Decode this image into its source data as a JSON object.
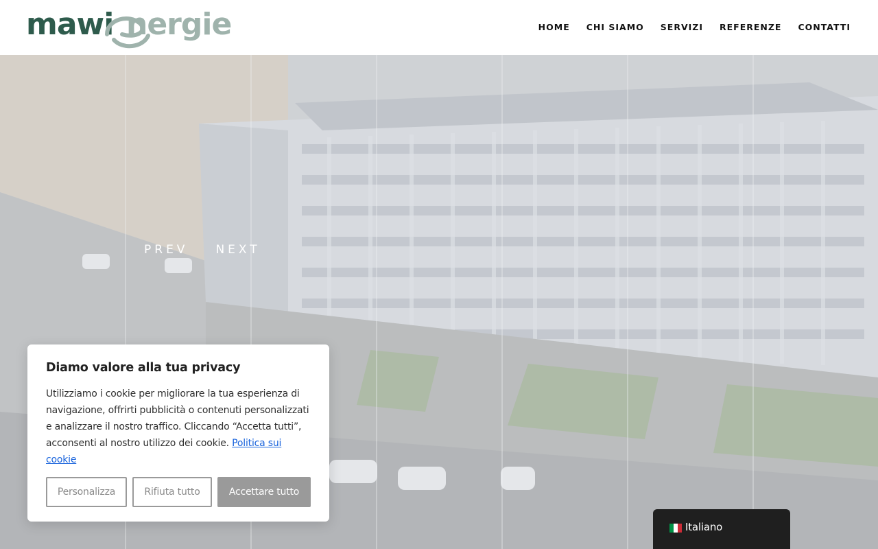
{
  "header": {
    "logo_part1": "mawi",
    "logo_part2": "nergie",
    "nav": [
      "HOME",
      "CHI SIAMO",
      "SERVIZI",
      "REFERENZE",
      "CONTATTI"
    ]
  },
  "hero": {
    "prev_label": "PREV",
    "next_label": "NEXT"
  },
  "cookie": {
    "title": "Diamo valore alla tua privacy",
    "text": "Utilizziamo i cookie per migliorare la tua esperienza di navigazione, offrirti pubblicità o contenuti personalizzati e analizzare il nostro traffico. Cliccando “Accetta tutti”, acconsenti al nostro utilizzo dei cookie.",
    "policy_link": "Politica sui cookie",
    "btn_customize": "Personalizza",
    "btn_reject": "Rifiuta tutto",
    "btn_accept": "Accettare tutto"
  },
  "language": {
    "label": "Italiano",
    "flag_icon": "italy-flag-icon"
  },
  "colors": {
    "brand_dark": "#2e5b4c",
    "brand_light": "#9fb3ac",
    "accept_button": "#9a9a9a",
    "link": "#1863dc",
    "lang_bg": "#1f1f1f"
  }
}
